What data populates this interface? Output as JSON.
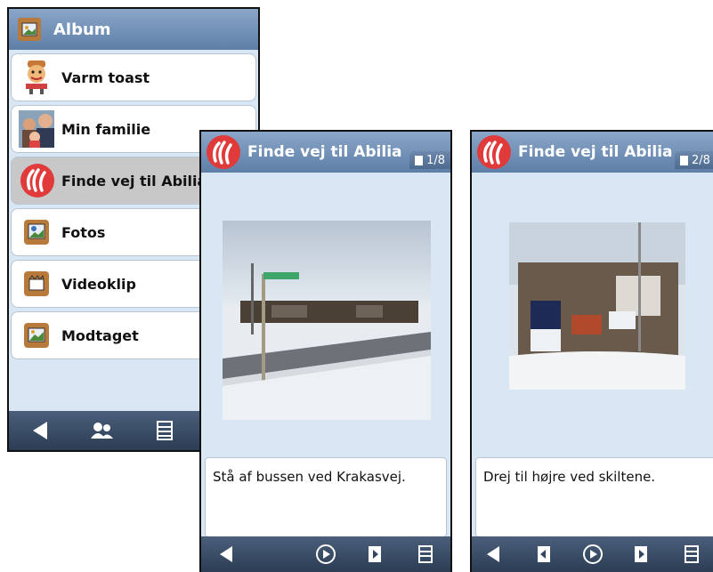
{
  "album": {
    "title": "Album",
    "items": [
      {
        "label": "Varm toast",
        "icon": "toast-person-icon"
      },
      {
        "label": "Min familie",
        "icon": "family-photo-icon"
      },
      {
        "label": "Finde vej til Abilia",
        "icon": "abilia-logo-icon"
      },
      {
        "label": "Fotos",
        "icon": "photos-icon"
      },
      {
        "label": "Videoklip",
        "icon": "video-icon"
      },
      {
        "label": "Modtaget",
        "icon": "received-icon"
      }
    ]
  },
  "story1": {
    "title": "Finde vej til Abilia",
    "counter": "1/8",
    "caption": "Stå af bussen ved Krakasvej."
  },
  "story2": {
    "title": "Finde vej til Abilia",
    "counter": "2/8",
    "caption": "Drej til højre ved skiltene."
  },
  "colors": {
    "titlebar": "#7291b8",
    "background": "#d9e6f3",
    "bottombar": "#34465f",
    "brand_red": "#e03a3a"
  }
}
